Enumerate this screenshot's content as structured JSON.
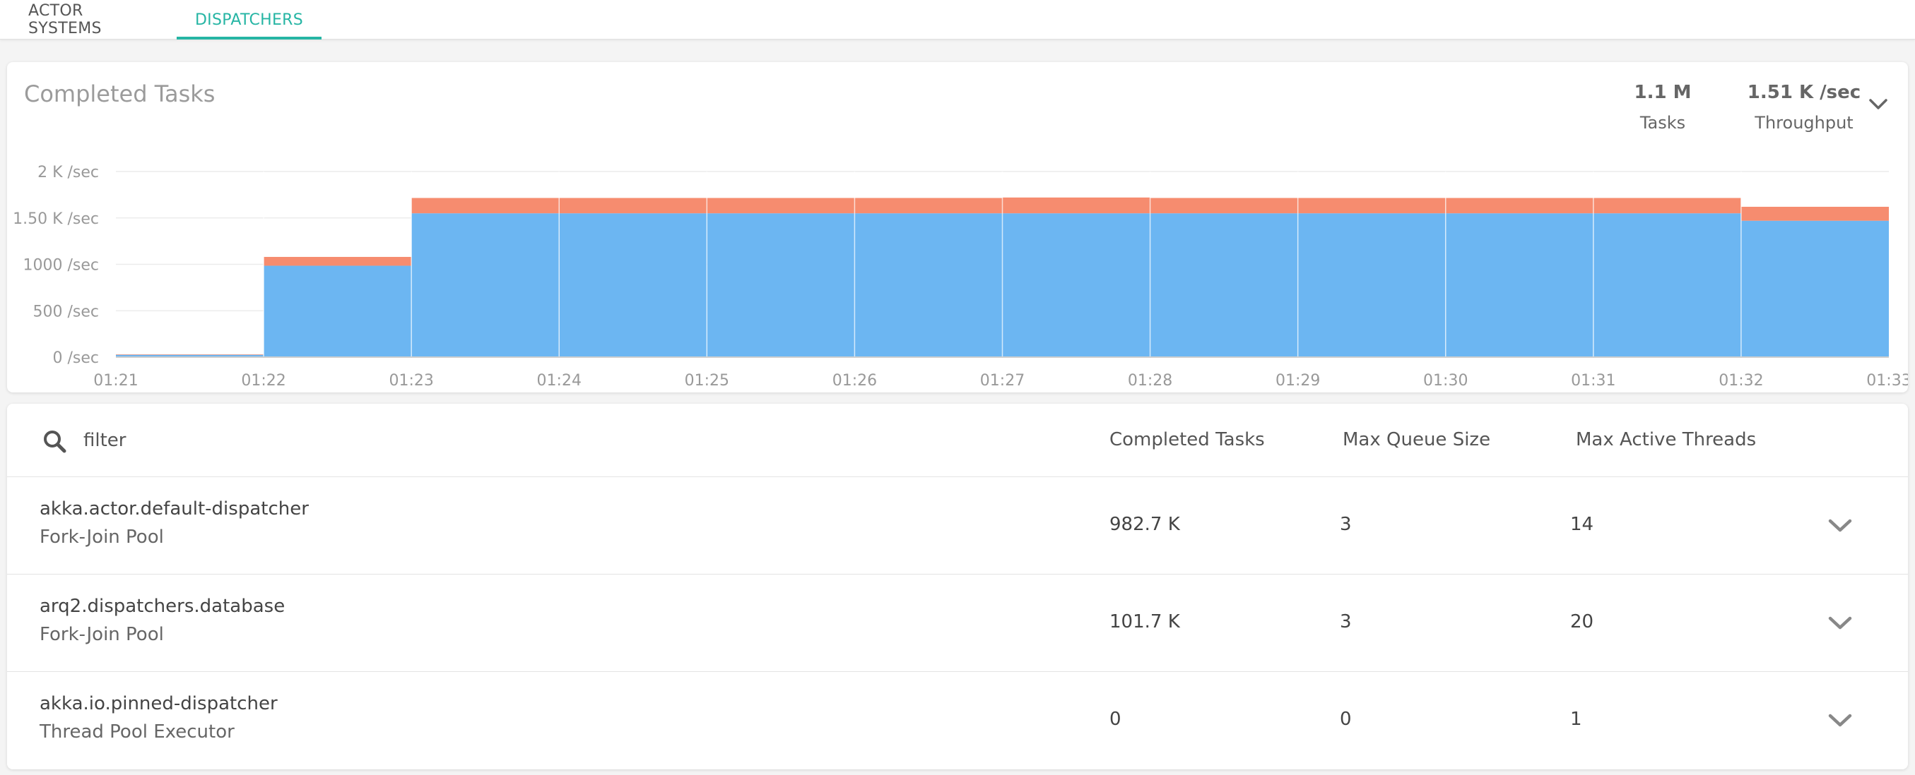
{
  "tabs": [
    {
      "label": "ACTOR SYSTEMS",
      "active": false
    },
    {
      "label": "DISPATCHERS",
      "active": true
    }
  ],
  "chart_card": {
    "title": "Completed Tasks",
    "stats": [
      {
        "value": "1.1 M",
        "label": "Tasks"
      },
      {
        "value": "1.51 K /sec",
        "label": "Throughput"
      }
    ],
    "expand_icon": "chevron-down-icon"
  },
  "chart_data": {
    "type": "area",
    "stacked": true,
    "title": "Completed Tasks",
    "x_tick_labels": [
      "01:21",
      "01:22",
      "01:23",
      "01:24",
      "01:25",
      "01:26",
      "01:27",
      "01:28",
      "01:29",
      "01:30",
      "01:31",
      "01:32",
      "01:33"
    ],
    "y_tick_labels": [
      "0 /sec",
      "500 /sec",
      "1000 /sec",
      "1.50 K /sec",
      "2 K /sec"
    ],
    "ylim": [
      0,
      2000
    ],
    "step": true,
    "grid": true,
    "series": [
      {
        "color": "#6cb6f2",
        "values": [
          25,
          985,
          1550,
          1550,
          1550,
          1550,
          1550,
          1550,
          1550,
          1550,
          1550,
          1470
        ]
      },
      {
        "color": "#f68c6f",
        "values": [
          5,
          95,
          165,
          165,
          165,
          165,
          170,
          165,
          165,
          165,
          165,
          150
        ]
      }
    ]
  },
  "table": {
    "filter_placeholder": "filter",
    "columns": [
      "Completed Tasks",
      "Max Queue Size",
      "Max Active Threads"
    ],
    "rows": [
      {
        "name": "akka.actor.default-dispatcher",
        "type": "Fork-Join Pool",
        "completed": "982.7 K",
        "max_queue": "3",
        "max_threads": "14"
      },
      {
        "name": "arq2.dispatchers.database",
        "type": "Fork-Join Pool",
        "completed": "101.7 K",
        "max_queue": "3",
        "max_threads": "20"
      },
      {
        "name": "akka.io.pinned-dispatcher",
        "type": "Thread Pool Executor",
        "completed": "0",
        "max_queue": "0",
        "max_threads": "1"
      }
    ]
  },
  "colors": {
    "accent": "#26b5a4",
    "series_primary": "#6cb6f2",
    "series_secondary": "#f68c6f"
  }
}
